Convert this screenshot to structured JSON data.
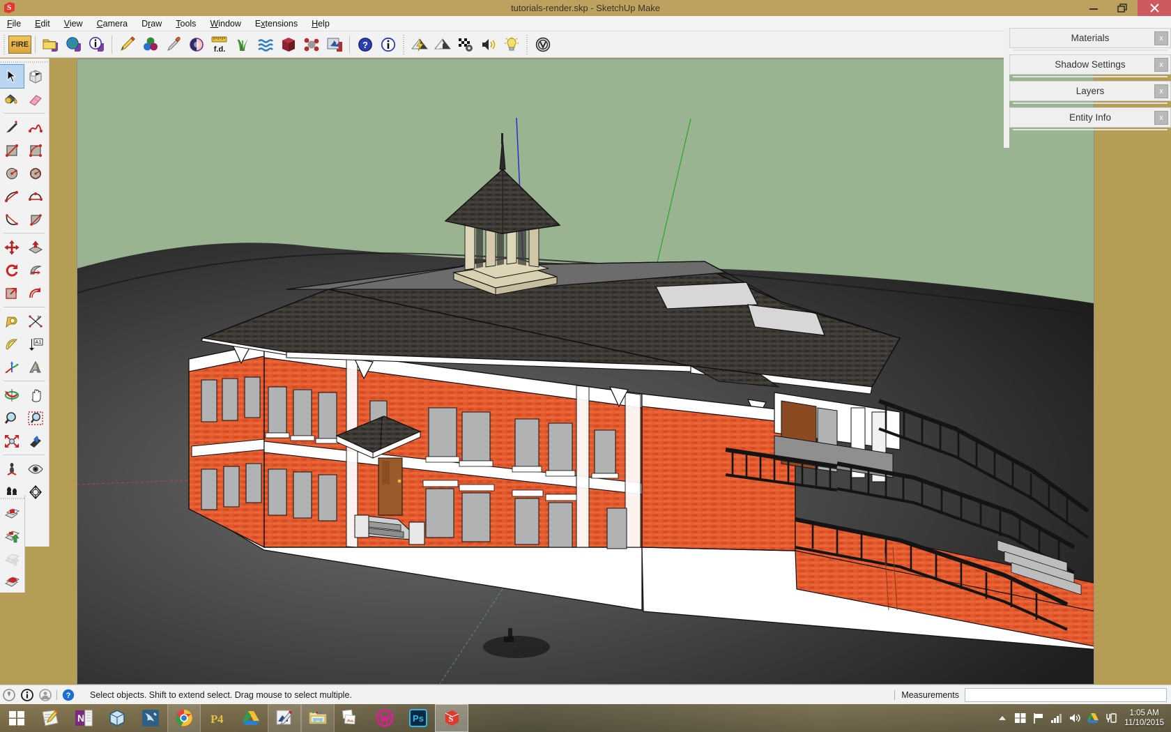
{
  "window": {
    "title": "tutorials-render.skp - SketchUp Make",
    "app_icon": "sketchup-logo-icon",
    "controls": [
      {
        "name": "minimize-button",
        "label": "–"
      },
      {
        "name": "restore-button",
        "label": "❐"
      },
      {
        "name": "close-button",
        "label": "✕"
      }
    ]
  },
  "menubar": {
    "items": [
      {
        "label": "File",
        "mnemonic": "F"
      },
      {
        "label": "Edit",
        "mnemonic": "E"
      },
      {
        "label": "View",
        "mnemonic": "V"
      },
      {
        "label": "Camera",
        "mnemonic": "C"
      },
      {
        "label": "Draw",
        "mnemonic": "D"
      },
      {
        "label": "Tools",
        "mnemonic": "T"
      },
      {
        "label": "Window",
        "mnemonic": "W"
      },
      {
        "label": "Extensions",
        "mnemonic": "x"
      },
      {
        "label": "Help",
        "mnemonic": "H"
      }
    ]
  },
  "toolbar": {
    "fire_label": "FIRE",
    "fd_label": "f.d.",
    "items": [
      {
        "name": "fire-render-button",
        "icon": "fire-text-icon",
        "tip": "FIRE Render"
      },
      {
        "name": "open-file-button",
        "icon": "folder-icon",
        "tip": "Open"
      },
      {
        "name": "globe-button",
        "icon": "globe-icon",
        "tip": "Geo Location"
      },
      {
        "name": "info-button",
        "icon": "info-circle-icon",
        "tip": "Info"
      },
      {
        "name": "pencil-button",
        "icon": "pencil-icon",
        "tip": "Edit"
      },
      {
        "name": "materials-button",
        "icon": "color-spheres-icon",
        "tip": "Materials"
      },
      {
        "name": "eyedropper-button",
        "icon": "eyedropper-icon",
        "tip": "Pick Material"
      },
      {
        "name": "contrast-button",
        "icon": "contrast-circle-icon",
        "tip": "Contrast"
      },
      {
        "name": "fd-ruler-button",
        "icon": "ruler-fd-icon",
        "tip": "f.d."
      },
      {
        "name": "grass-button",
        "icon": "grass-icon",
        "tip": "Grass / Fur"
      },
      {
        "name": "water-button",
        "icon": "water-waves-icon",
        "tip": "Water"
      },
      {
        "name": "cube-button",
        "icon": "red-cube-icon",
        "tip": "Geometry"
      },
      {
        "name": "particles-button",
        "icon": "molecule-icon",
        "tip": "Particles"
      },
      {
        "name": "image-export-button",
        "icon": "image-arrow-icon",
        "tip": "Export"
      },
      {
        "name": "help-button",
        "icon": "question-circle-icon",
        "tip": "Help"
      },
      {
        "name": "about-button",
        "icon": "info-circle-blue-icon",
        "tip": "About"
      },
      {
        "name": "quick-render-button",
        "icon": "render-lightning-icon",
        "tip": "Quick Render"
      },
      {
        "name": "render-button",
        "icon": "render-icon",
        "tip": "Render"
      },
      {
        "name": "render-settings-button",
        "icon": "checker-gear-icon",
        "tip": "Render Options"
      },
      {
        "name": "sound-button",
        "icon": "speaker-icon",
        "tip": "Sound"
      },
      {
        "name": "lights-button",
        "icon": "lightbulb-icon",
        "tip": "Lights"
      },
      {
        "name": "vray-button",
        "icon": "vray-logo-icon",
        "tip": "V-Ray"
      }
    ]
  },
  "left_palette": {
    "groups": [
      {
        "tools": [
          {
            "name": "select-tool",
            "icon": "arrow-cursor-icon",
            "active": true
          },
          {
            "name": "make-component-tool",
            "icon": "component-box-icon",
            "active": false
          },
          {
            "name": "paint-bucket-tool",
            "icon": "paint-bucket-icon",
            "active": false
          },
          {
            "name": "eraser-tool",
            "icon": "eraser-icon",
            "active": false
          }
        ]
      },
      {
        "tools": [
          {
            "name": "line-tool",
            "icon": "pencil-line-icon",
            "active": false
          },
          {
            "name": "freehand-tool",
            "icon": "freehand-squiggle-icon",
            "active": false
          },
          {
            "name": "rectangle-tool",
            "icon": "rectangle-icon",
            "active": false
          },
          {
            "name": "rotated-rectangle-tool",
            "icon": "rotated-rectangle-icon",
            "active": false
          },
          {
            "name": "circle-tool",
            "icon": "circle-icon",
            "active": false
          },
          {
            "name": "polygon-tool",
            "icon": "polygon-icon",
            "active": false
          },
          {
            "name": "arc-tool",
            "icon": "arc-icon",
            "active": false
          },
          {
            "name": "two-point-arc-tool",
            "icon": "two-point-arc-icon",
            "active": false
          },
          {
            "name": "three-point-arc-tool",
            "icon": "three-point-arc-icon",
            "active": false
          },
          {
            "name": "pie-tool",
            "icon": "pie-icon",
            "active": false
          }
        ]
      },
      {
        "tools": [
          {
            "name": "move-tool",
            "icon": "move-arrows-icon",
            "active": false
          },
          {
            "name": "push-pull-tool",
            "icon": "push-pull-icon",
            "active": false
          },
          {
            "name": "rotate-tool",
            "icon": "rotate-icon",
            "active": false
          },
          {
            "name": "follow-me-tool",
            "icon": "follow-me-icon",
            "active": false
          },
          {
            "name": "scale-tool",
            "icon": "scale-icon",
            "active": false
          },
          {
            "name": "offset-tool",
            "icon": "offset-icon",
            "active": false
          }
        ]
      },
      {
        "tools": [
          {
            "name": "tape-measure-tool",
            "icon": "tape-measure-icon",
            "active": false
          },
          {
            "name": "dimension-tool",
            "icon": "dimension-icon",
            "active": false
          },
          {
            "name": "protractor-tool",
            "icon": "protractor-icon",
            "active": false
          },
          {
            "name": "text-tool",
            "icon": "text-a1-icon",
            "active": false
          },
          {
            "name": "axes-tool",
            "icon": "axes-icon",
            "active": false
          },
          {
            "name": "three-d-text-tool",
            "icon": "3d-text-icon",
            "active": false
          }
        ]
      },
      {
        "tools": [
          {
            "name": "orbit-tool",
            "icon": "orbit-icon",
            "active": false
          },
          {
            "name": "pan-tool",
            "icon": "hand-pan-icon",
            "active": false
          },
          {
            "name": "zoom-tool",
            "icon": "magnifier-icon",
            "active": false
          },
          {
            "name": "zoom-window-tool",
            "icon": "zoom-window-icon",
            "active": false
          },
          {
            "name": "zoom-extents-tool",
            "icon": "zoom-extents-icon",
            "active": false
          },
          {
            "name": "previous-view-tool",
            "icon": "previous-view-icon",
            "active": false
          }
        ]
      },
      {
        "tools": [
          {
            "name": "position-camera-tool",
            "icon": "position-camera-icon",
            "active": false
          },
          {
            "name": "look-around-tool",
            "icon": "eye-icon",
            "active": false
          },
          {
            "name": "walk-tool",
            "icon": "footprints-icon",
            "active": false
          },
          {
            "name": "north-tool",
            "icon": "compass-icon",
            "active": false
          }
        ]
      }
    ],
    "secondary_group": [
      {
        "name": "layout-send-button",
        "icon": "layout-stack-icon"
      },
      {
        "name": "layout-update-button",
        "icon": "layout-stack-up-icon"
      },
      {
        "name": "layout-disabled-button",
        "icon": "layout-stack-gray-icon"
      },
      {
        "name": "layout-red-button",
        "icon": "layout-stack-red-icon"
      }
    ]
  },
  "right_tray": {
    "panels": [
      {
        "name": "panel-materials",
        "title": "Materials",
        "close_label": "x"
      },
      {
        "name": "panel-shadow-settings",
        "title": "Shadow Settings",
        "close_label": "x"
      },
      {
        "name": "panel-layers",
        "title": "Layers",
        "close_label": "x"
      },
      {
        "name": "panel-entity-info",
        "title": "Entity Info",
        "close_label": "x"
      }
    ]
  },
  "statusbar": {
    "icons": [
      {
        "name": "geo-location-icon"
      },
      {
        "name": "credits-icon"
      },
      {
        "name": "user-account-icon"
      },
      {
        "name": "help-instructor-icon"
      }
    ],
    "message": "Select objects. Shift to extend select. Drag mouse to select multiple.",
    "measurements_label": "Measurements",
    "measurements_value": "",
    "measurements_placeholder": ""
  },
  "viewport": {
    "scene": "3d-model-brick-school-building",
    "sky_color": "#9ab391",
    "ground_color": "#4d4d4d",
    "brick_color": "#e4552c",
    "trim_color": "#ffffff",
    "roof_color": "#3a3632",
    "window_color": "#b0b2b3",
    "cupola_color": "#d9d2b2",
    "railing_color": "#171717",
    "door_color": "#9b5a2a",
    "axis_blue": "#2222dd",
    "axis_green": "#22aa22",
    "axis_red": "#cc2222"
  },
  "taskbar": {
    "items": [
      {
        "name": "taskbar-start-button",
        "icon": "windows-logo-icon",
        "state": "pinned"
      },
      {
        "name": "taskbar-notepad",
        "icon": "notepad-pencil-icon",
        "state": "pinned"
      },
      {
        "name": "taskbar-onenote",
        "icon": "onenote-icon",
        "state": "pinned"
      },
      {
        "name": "taskbar-3d-builder",
        "icon": "cube-3d-icon",
        "state": "pinned"
      },
      {
        "name": "taskbar-mysql",
        "icon": "dolphin-icon",
        "state": "pinned"
      },
      {
        "name": "taskbar-chrome",
        "icon": "chrome-icon",
        "state": "running"
      },
      {
        "name": "taskbar-perforce",
        "icon": "p4-icon",
        "state": "pinned"
      },
      {
        "name": "taskbar-google-drive",
        "icon": "drive-triangle-icon",
        "state": "pinned"
      },
      {
        "name": "taskbar-paint",
        "icon": "paint-brush-icon",
        "state": "running"
      },
      {
        "name": "taskbar-explorer",
        "icon": "folder-explorer-icon",
        "state": "running"
      },
      {
        "name": "taskbar-photos",
        "icon": "photos-icon",
        "state": "pinned"
      },
      {
        "name": "taskbar-wacom",
        "icon": "wacom-w-icon",
        "state": "pinned"
      },
      {
        "name": "taskbar-photoshop",
        "icon": "photoshop-ps-icon",
        "state": "pinned"
      },
      {
        "name": "taskbar-sketchup",
        "icon": "sketchup-logo-icon",
        "state": "active"
      }
    ],
    "tray": [
      {
        "name": "tray-show-hidden-icon",
        "icon": "chevron-up-icon"
      },
      {
        "name": "tray-windows-icon",
        "icon": "windows-logo-icon"
      },
      {
        "name": "tray-action-center-icon",
        "icon": "flag-icon"
      },
      {
        "name": "tray-network-icon",
        "icon": "signal-bars-icon"
      },
      {
        "name": "tray-volume-icon",
        "icon": "speaker-icon"
      },
      {
        "name": "tray-drive-icon",
        "icon": "drive-triangle-icon"
      },
      {
        "name": "tray-device-icon",
        "icon": "usb-device-icon"
      }
    ],
    "clock": {
      "time": "1:05 AM",
      "date": "11/10/2015"
    }
  }
}
